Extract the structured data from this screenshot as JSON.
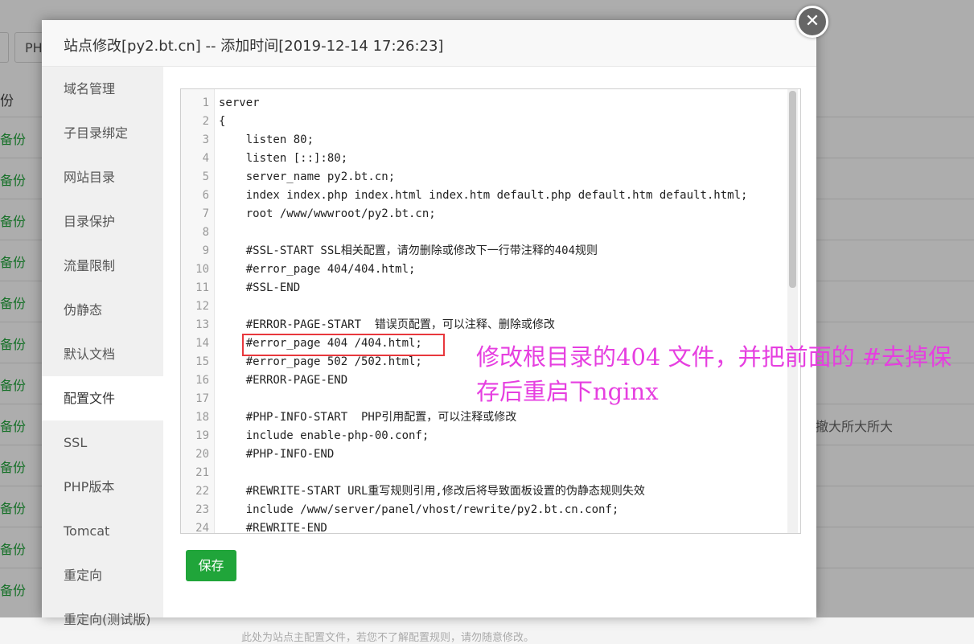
{
  "background": {
    "buttons": [
      "",
      "PH"
    ],
    "column_header": "份",
    "row_action": "备份",
    "row_count": 12,
    "right_text": "撤大所大所大"
  },
  "modal": {
    "title": "站点修改[py2.bt.cn] -- 添加时间[2019-12-14 17:26:23]",
    "close_label": "✕",
    "sidebar": [
      {
        "label": "域名管理"
      },
      {
        "label": "子目录绑定"
      },
      {
        "label": "网站目录"
      },
      {
        "label": "目录保护"
      },
      {
        "label": "流量限制"
      },
      {
        "label": "伪静态"
      },
      {
        "label": "默认文档"
      },
      {
        "label": "配置文件",
        "active": true
      },
      {
        "label": "SSL"
      },
      {
        "label": "PHP版本"
      },
      {
        "label": "Tomcat"
      },
      {
        "label": "重定向"
      },
      {
        "label": "重定向(测试版)"
      }
    ],
    "save_label": "保存",
    "footer_text": "此处为站点主配置文件，若您不了解配置规则，请勿随意修改。"
  },
  "editor": {
    "lines": [
      "server",
      "{",
      "    listen 80;",
      "    listen [::]:80;",
      "    server_name py2.bt.cn;",
      "    index index.php index.html index.htm default.php default.htm default.html;",
      "    root /www/wwwroot/py2.bt.cn;",
      "",
      "    #SSL-START SSL相关配置，请勿删除或修改下一行带注释的404规则",
      "    #error_page 404/404.html;",
      "    #SSL-END",
      "",
      "    #ERROR-PAGE-START  错误页配置，可以注释、删除或修改",
      "    #error_page 404 /404.html;",
      "    #error_page 502 /502.html;",
      "    #ERROR-PAGE-END",
      "",
      "    #PHP-INFO-START  PHP引用配置，可以注释或修改",
      "    include enable-php-00.conf;",
      "    #PHP-INFO-END",
      "",
      "    #REWRITE-START URL重写规则引用,修改后将导致面板设置的伪静态规则失效",
      "    include /www/server/panel/vhost/rewrite/py2.bt.cn.conf;",
      "    #REWRITE-END"
    ],
    "highlighted_line": 14,
    "annotation": "修改根目录的404 文件，并把前面的 #去掉保存后重启下nginx",
    "annotation_color": "#e63fe0",
    "highlight_color": "#e8383d",
    "accent_color": "#20a53a"
  }
}
